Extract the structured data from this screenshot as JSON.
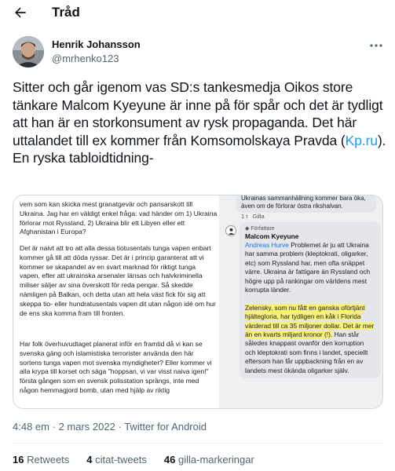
{
  "header": {
    "title": "Tråd",
    "back_icon": "arrow-left-icon"
  },
  "author": {
    "name": "Henrik Johansson",
    "handle": "@mrhenko123",
    "more_icon": "more-horizontal-icon"
  },
  "tweet": {
    "text_before_link": "Sitter och går igenom vas SD:s tankesmedja Oikos store tänkare Malcom Kyeyune är inne på för spår och det är tydligt att han är en storkonsument av rysk propaganda. Det här uttalandet till ex kommer från Komsomolskaya Pravda (",
    "link_text": "Kp.ru",
    "text_after_link": "). En ryska tabloidtidning-"
  },
  "media": {
    "article_paragraphs": [
      "vem som kan skicka mest granatgevär och pansarskott till Ukraina. Jag har en väldigt enkel fråga: vad händer om 1) Ukraina förlorar mot Ryssland, 2) Ukraina blir ett Libyen eller ett Afghanistan i Europa?",
      "Det är naivt att tro att alla dessa tiotusentals tunga vapen enbart kommer gå till att döda ryssar. Det är i princip garanterat att vi kommer se skapandet av en svart marknad för riktigt tunga vapen, efter att ukrainska arsenaler länsas och halvkriminella miliser säljer av sina överskott för reda pengar. Så skedde nämligen på Balkan, och detta utan att hela väst fick för sig att skeppa tio- eller hundratusentals vapen dit utan någon idé om hur de ens ska komma fram till fronten.",
      "Har folk överhuvudtaget planerat inför en framtid då vi kan se svenska gäng och islamistiska terrorister använda den här sortens tunga vapen mot svenska myndigheter? Eller kommer vi alla krypa till korset och säga \"hoppsan, vi var visst naiva igen!\" första gången som en svensk polisstation sprängs, inte med någon hemmagjord bomb, utan med hjälp av riktig"
    ],
    "previous_comment": "Ukrainas sammanhållning kommer bara öka, även om de förlorar östra rikshalvan.",
    "comment_time": "1 t",
    "comment_like": "Gilla",
    "reply_badge": "Författare",
    "reply_author": "Malcom Kyeyune",
    "reply_mention": "Andreas Hurve",
    "reply_text_1": " Problemet är ju att Ukraina har samma problem (kleptokrati, oligarker, etc) som Ryssland har, men ofta snäppet värre. Ukraina är fattigare än Ryssland och högre upp på rankingar om världens mest korrupta länder.",
    "reply_highlight": "Zelensky, som nu fått en ganska oförtjänt hjältegloria, har tydligen en kåk i Florida värderad till ca 35 miljoner dollar. Det är mer än en kvarts miljard kronor (!).",
    "reply_text_2": " Han står således knappast ovanför den korruption och kleptokrati som finns i landet, speciellt eftersom han får uppbackning från en av landets mest ökända oligarker själv."
  },
  "meta": {
    "time": "4:48 em",
    "date": "2 mars 2022",
    "source": "Twitter for Android",
    "separator": "·"
  },
  "stats": {
    "retweets_count": "16",
    "retweets_label": "Retweets",
    "quotes_count": "4",
    "quotes_label": "citat-tweets",
    "likes_count": "46",
    "likes_label": "gilla-markeringar"
  },
  "colors": {
    "link": "#1d9bf0",
    "secondary_text": "#536471",
    "highlight": "#f7f07a"
  }
}
